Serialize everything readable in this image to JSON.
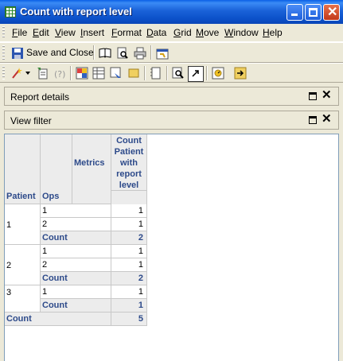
{
  "window": {
    "title": "Count with report level",
    "controls": [
      "minimize",
      "maximize",
      "close"
    ]
  },
  "menu": [
    {
      "label": "File",
      "accel": "F",
      "rest": "ile"
    },
    {
      "label": "Edit",
      "accel": "E",
      "rest": "dit"
    },
    {
      "label": "View",
      "accel": "V",
      "rest": "iew"
    },
    {
      "label": "Insert",
      "accel": "I",
      "rest": "nsert"
    },
    {
      "label": "Format",
      "accel": "F",
      "rest": "ormat"
    },
    {
      "label": "Data",
      "accel": "D",
      "rest": "ata"
    },
    {
      "label": "Grid",
      "accel": "G",
      "rest": "rid"
    },
    {
      "label": "Move",
      "accel": "M",
      "rest": "ove"
    },
    {
      "label": "Window",
      "accel": "W",
      "rest": "indow"
    },
    {
      "label": "Help",
      "accel": "H",
      "rest": "elp"
    }
  ],
  "toolbar1": {
    "save_close_label": "Save and Close",
    "icons": [
      "save-icon",
      "book-icon",
      "print-preview-icon",
      "printer-icon",
      "properties-icon"
    ]
  },
  "toolbar2": {
    "icons": [
      "wand-icon",
      "dropdown-arrow-icon",
      "page-icon",
      "help-icon",
      "grid-mode-icon",
      "grid-graph-icon",
      "design-mode-icon",
      "filter-icon",
      "note-icon",
      "notebook-icon",
      "find-icon",
      "cursor-icon",
      "report-objects-icon",
      "export-icon"
    ]
  },
  "panels": {
    "report_details": "Report details",
    "view_filter": "View filter"
  },
  "grid": {
    "row_headers": [
      "Patient",
      "Ops"
    ],
    "metrics_label": "Metrics",
    "metric_header": [
      "Count",
      "Patient",
      "with",
      "report",
      "level"
    ],
    "rows": [
      {
        "patient": "1",
        "ops": "1",
        "value": "1"
      },
      {
        "patient": "",
        "ops": "2",
        "value": "1"
      },
      {
        "patient": "",
        "ops": "Count",
        "value": "2",
        "subtotal": true
      },
      {
        "patient": "2",
        "ops": "1",
        "value": "1"
      },
      {
        "patient": "",
        "ops": "2",
        "value": "1"
      },
      {
        "patient": "",
        "ops": "Count",
        "value": "2",
        "subtotal": true
      },
      {
        "patient": "3",
        "ops": "1",
        "value": "1"
      },
      {
        "patient": "",
        "ops": "Count",
        "value": "1",
        "subtotal": true
      }
    ],
    "grand_total": {
      "label": "Count",
      "value": "5"
    }
  },
  "colors": {
    "titlebar": "#0a5fe6",
    "chrome": "#ece9d8",
    "header_text": "#2d4a8a",
    "header_bg": "#ececec"
  }
}
